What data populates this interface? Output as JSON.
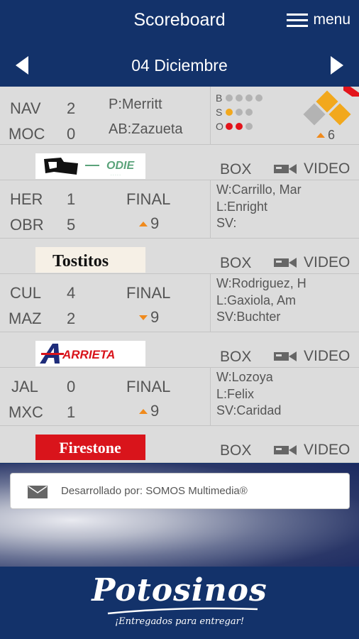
{
  "header": {
    "title": "Scoreboard",
    "menu_label": "menu"
  },
  "date_nav": {
    "date": "04 Diciembre"
  },
  "games": [
    {
      "away": {
        "team": "NAV",
        "runs": "2"
      },
      "home": {
        "team": "MOC",
        "runs": "0"
      },
      "pitcher": "P:Merritt",
      "batter": "AB:Zazueta",
      "live": {
        "balls_label": "B",
        "strikes_label": "S",
        "outs_label": "O",
        "balls": 0,
        "strikes": 1,
        "outs": 2,
        "inning": "6",
        "badge": "Live"
      },
      "sponsor": "New Era / Odie"
    },
    {
      "away": {
        "team": "HER",
        "runs": "1"
      },
      "home": {
        "team": "OBR",
        "runs": "5"
      },
      "status": "FINAL",
      "inning": "9",
      "inning_dir": "up",
      "win": "W:Carrillo, Mar",
      "loss": "L:Enright",
      "save": "SV:",
      "sponsor": "Tostitos"
    },
    {
      "away": {
        "team": "CUL",
        "runs": "4"
      },
      "home": {
        "team": "MAZ",
        "runs": "2"
      },
      "status": "FINAL",
      "inning": "9",
      "inning_dir": "down",
      "win": "W:Rodriguez, H",
      "loss": "L:Gaxiola, Am",
      "save": "SV:Buchter",
      "sponsor": "Arrieta"
    },
    {
      "away": {
        "team": "JAL",
        "runs": "0"
      },
      "home": {
        "team": "MXC",
        "runs": "1"
      },
      "status": "FINAL",
      "inning": "9",
      "inning_dir": "up",
      "win": "W:Lozoya",
      "loss": "L:Felix",
      "save": "SV:Caridad",
      "sponsor": "Firestone"
    }
  ],
  "links": {
    "box": "BOX",
    "video": "VIDEO"
  },
  "developer": {
    "text": "Desarrollado por: SOMOS Multimedia®"
  },
  "footer": {
    "brand": "Potosinos",
    "tagline": "¡Entregados para entregar!"
  },
  "colors": {
    "primary": "#13326a",
    "accent": "#f08a1c",
    "row_bg": "#dcdcdc",
    "out_red": "#e3141b",
    "strike_orange": "#f2a81c"
  },
  "icons": [
    "chevron-left-icon",
    "chevron-right-icon",
    "hamburger-menu-icon",
    "video-camera-icon",
    "mail-icon"
  ]
}
